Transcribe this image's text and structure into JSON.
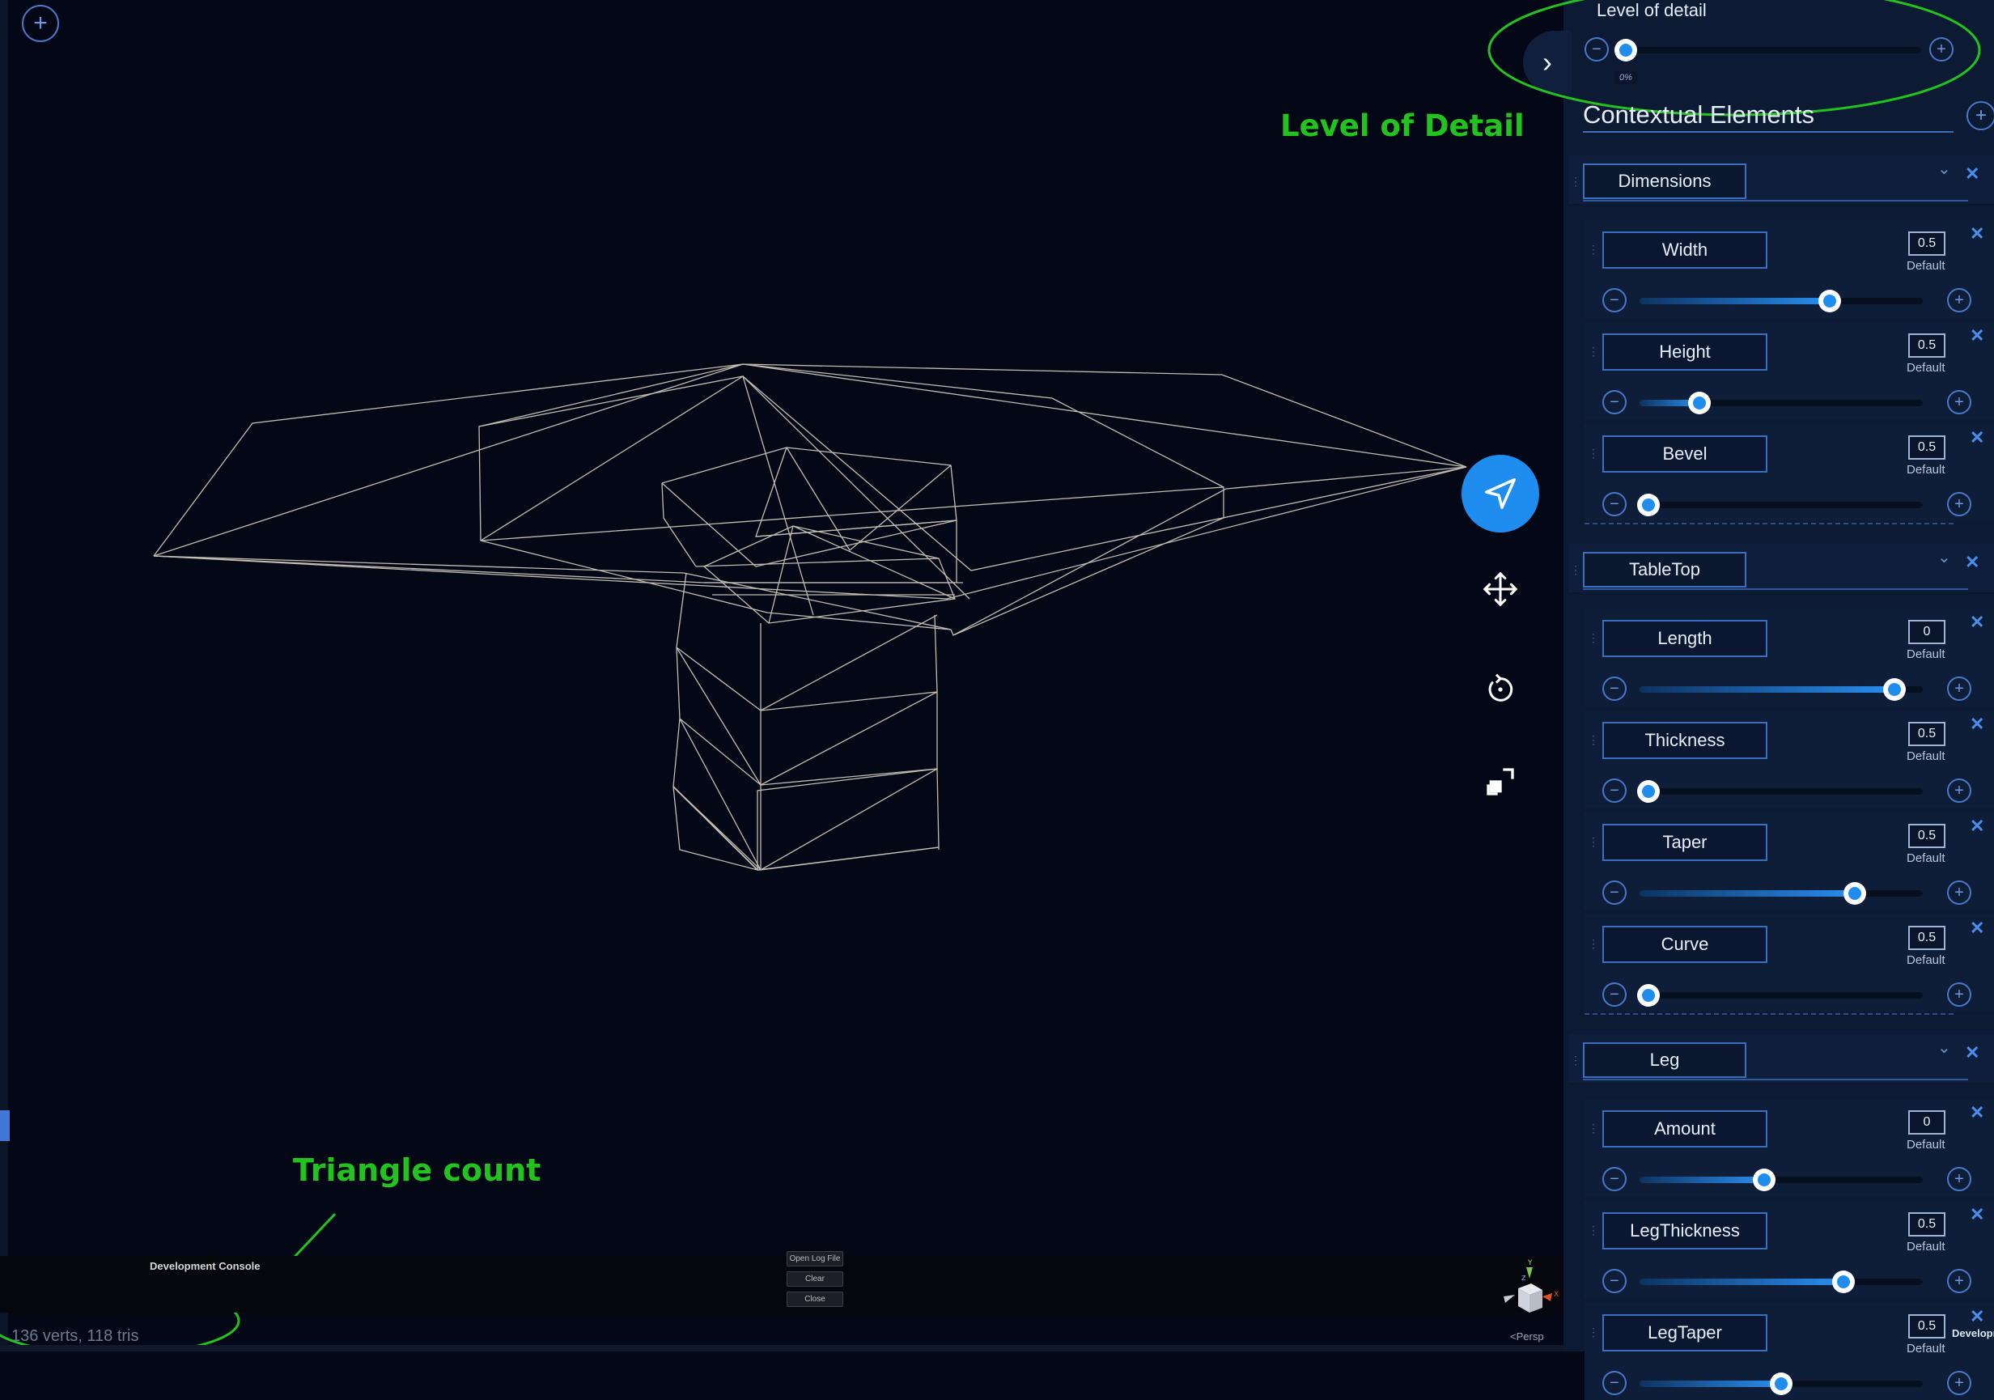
{
  "viewport": {
    "stats": "136 verts, 118 tris",
    "persp_label": "<Persp",
    "annotations": {
      "level_of_detail": "Level of Detail",
      "triangle_count": "Triangle count"
    }
  },
  "console": {
    "title": "Development Console",
    "buttons": [
      "Open Log File",
      "Clear",
      "Close"
    ]
  },
  "panel": {
    "lod": {
      "title": "Level of detail",
      "value": "0%",
      "level": 0.0
    },
    "contextual_title": "Contextual Elements",
    "default_label": "Default",
    "groups": [
      {
        "name": "Dimensions",
        "params": [
          {
            "label": "Width",
            "value": "0.5",
            "level": 0.67
          },
          {
            "label": "Height",
            "value": "0.5",
            "level": 0.21
          },
          {
            "label": "Bevel",
            "value": "0.5",
            "level": 0.03
          }
        ]
      },
      {
        "name": "TableTop",
        "params": [
          {
            "label": "Length",
            "value": "0",
            "level": 0.9
          },
          {
            "label": "Thickness",
            "value": "0.5",
            "level": 0.03
          },
          {
            "label": "Taper",
            "value": "0.5",
            "level": 0.76
          },
          {
            "label": "Curve",
            "value": "0.5",
            "level": 0.03
          }
        ]
      },
      {
        "name": "Leg",
        "params": [
          {
            "label": "Amount",
            "value": "0",
            "level": 0.44
          },
          {
            "label": "LegThickness",
            "value": "0.5",
            "level": 0.72
          },
          {
            "label": "LegTaper",
            "value": "0.5",
            "level": 0.5
          }
        ]
      }
    ],
    "dev_build": "Development Build"
  },
  "colors": {
    "accent": "#1f8cf0",
    "annotation": "#22c31f",
    "background": "#040816",
    "panel": "#0c1a33"
  }
}
